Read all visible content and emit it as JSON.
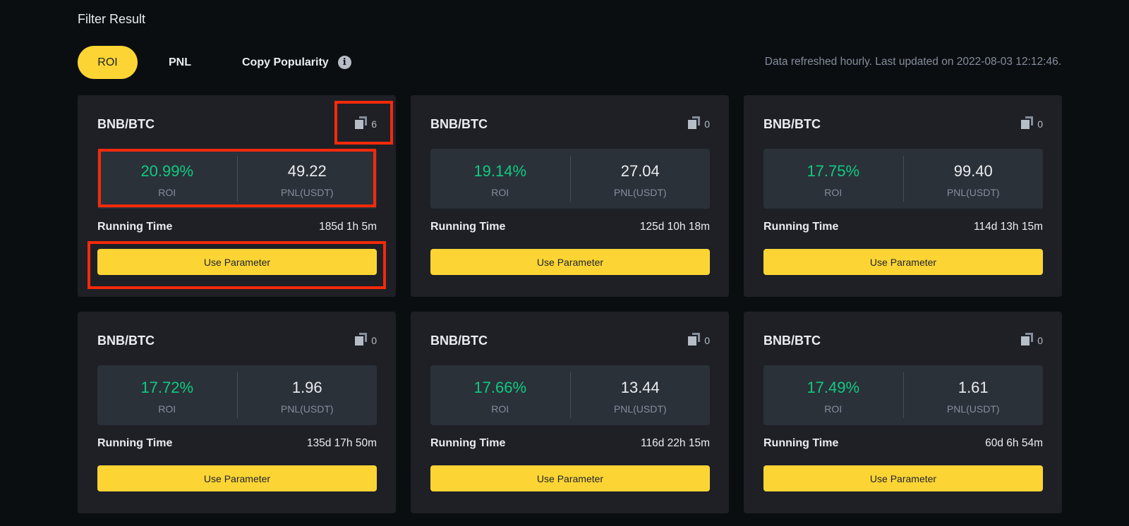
{
  "section": {
    "title": "Filter Result"
  },
  "tabs": [
    {
      "label": "ROI",
      "active": true
    },
    {
      "label": "PNL",
      "active": false
    },
    {
      "label": "Copy Popularity",
      "active": false,
      "icon": "info-icon"
    }
  ],
  "refresh_note": "Data refreshed hourly. Last updated on 2022-08-03 12:12:46.",
  "labels": {
    "roi": "ROI",
    "pnl": "PNL(USDT)",
    "running_time": "Running Time",
    "use_parameter": "Use Parameter"
  },
  "colors": {
    "accent": "#fcd535",
    "positive": "#0ecb81",
    "highlight_box": "#f42a0b"
  },
  "cards": [
    {
      "pair": "BNB/BTC",
      "copies": "6",
      "roi": "20.99%",
      "pnl": "49.22",
      "running_time": "185d 1h 5m"
    },
    {
      "pair": "BNB/BTC",
      "copies": "0",
      "roi": "19.14%",
      "pnl": "27.04",
      "running_time": "125d 10h 18m"
    },
    {
      "pair": "BNB/BTC",
      "copies": "0",
      "roi": "17.75%",
      "pnl": "99.40",
      "running_time": "114d 13h 15m"
    },
    {
      "pair": "BNB/BTC",
      "copies": "0",
      "roi": "17.72%",
      "pnl": "1.96",
      "running_time": "135d 17h 50m"
    },
    {
      "pair": "BNB/BTC",
      "copies": "0",
      "roi": "17.66%",
      "pnl": "13.44",
      "running_time": "116d 22h 15m"
    },
    {
      "pair": "BNB/BTC",
      "copies": "0",
      "roi": "17.49%",
      "pnl": "1.61",
      "running_time": "60d 6h 54m"
    }
  ]
}
